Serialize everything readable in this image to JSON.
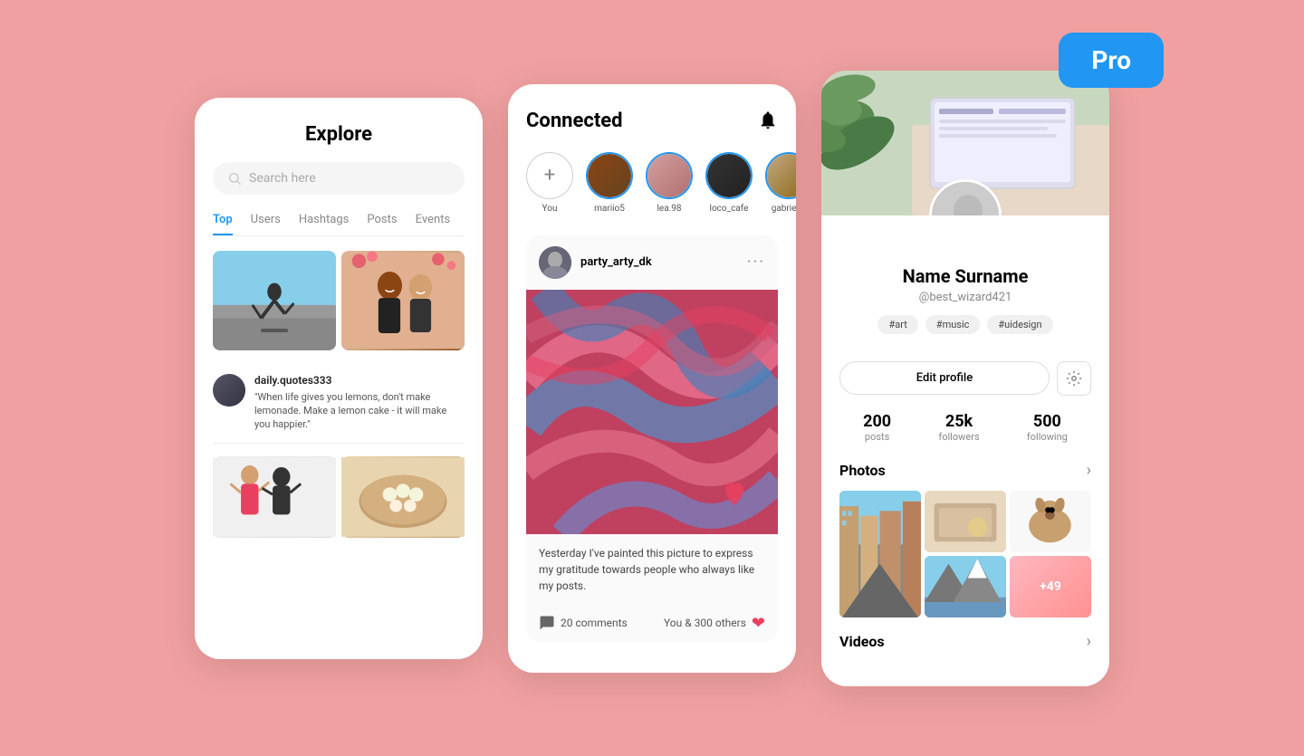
{
  "background_color": "#f0a0a0",
  "pro_badge": {
    "label": "Pro",
    "color": "#2196F3"
  },
  "explore": {
    "title": "Explore",
    "search_placeholder": "Search here",
    "tabs": [
      {
        "label": "Top",
        "active": true
      },
      {
        "label": "Users",
        "active": false
      },
      {
        "label": "Hashtags",
        "active": false
      },
      {
        "label": "Posts",
        "active": false
      },
      {
        "label": "Events",
        "active": false
      }
    ],
    "quote_post": {
      "username": "daily.quotes333",
      "quote": "\"When life gives you lemons, don't make lemonade. Make a lemon cake - it will make you happier.\""
    }
  },
  "connected": {
    "title": "Connected",
    "stories": [
      {
        "label": "You",
        "type": "add"
      },
      {
        "label": "mariio5",
        "type": "story"
      },
      {
        "label": "lea.98",
        "type": "story"
      },
      {
        "label": "loco_cafe",
        "type": "story"
      },
      {
        "label": "gabriel.g",
        "type": "story"
      }
    ],
    "post": {
      "username": "party_arty_dk",
      "caption": "Yesterday I've painted this picture to express my gratitude towards people who always like my posts.",
      "comments_count": "20 comments",
      "likes_text": "You & 300 others"
    }
  },
  "profile": {
    "name": "Name Surname",
    "handle": "@best_wizard421",
    "tags": [
      "#art",
      "#music",
      "#uidesign"
    ],
    "edit_profile_label": "Edit profile",
    "stats": [
      {
        "number": "200",
        "label": "posts"
      },
      {
        "number": "25k",
        "label": "followers"
      },
      {
        "number": "500",
        "label": "following"
      }
    ],
    "photos_section_title": "Photos",
    "photo_more_count": "+49",
    "videos_section_title": "Videos"
  }
}
